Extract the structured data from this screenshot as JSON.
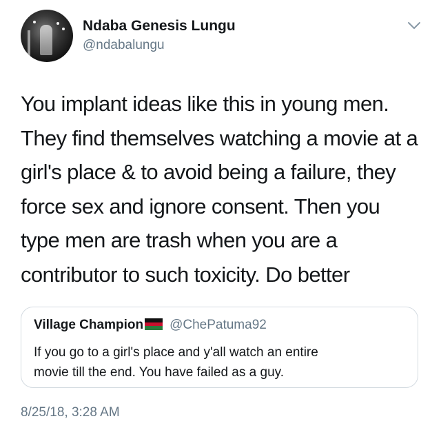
{
  "author": {
    "name": "Ndaba Genesis Lungu",
    "handle": "@ndabalungu"
  },
  "icons": {
    "avatar": "profile-photo",
    "menu": "chevron-down-icon"
  },
  "tweet": {
    "text": "You implant ideas like this in young men.\nThey find themselves watching a movie at a\ngirl's place & to avoid being a failure, they\nforce sex and ignore consent. Then you\ntype men are trash when you are a\ncontributor to such toxicity. Do better"
  },
  "quoted_tweet": {
    "name": "Village Champion",
    "flag": "malawi-flag-icon",
    "handle": "@ChePatuma92",
    "text": "If you go to a girl's place and y'all watch an entire\nmovie till the end. You have failed as a guy."
  },
  "timestamp": "8/25/18, 3:28 AM",
  "colors": {
    "text": "#14171a",
    "secondary": "#657786",
    "border": "#d4dbe1"
  }
}
